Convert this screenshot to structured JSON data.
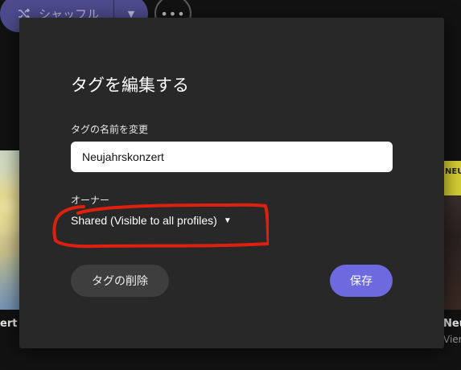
{
  "background": {
    "shuffle_label": "シャッフル",
    "left_album_caption": "ert",
    "right_album_caption": "Neujal",
    "right_album_subcaption": "Viene",
    "right_album_cover_text": "NEU"
  },
  "dialog": {
    "title": "タグを編集する",
    "rename_label": "タグの名前を変更",
    "tag_name_value": "Neujahrskonzert",
    "owner_label": "オーナー",
    "owner_value": "Shared (Visible to all profiles)",
    "delete_label": "タグの削除",
    "save_label": "保存"
  },
  "colors": {
    "dialog_bg": "#282828",
    "accent": "#6d69de",
    "annotation": "#e0200f"
  },
  "icons": {
    "shuffle": "shuffle-icon",
    "more": "more-icon",
    "caret": "chevron-down-icon"
  }
}
